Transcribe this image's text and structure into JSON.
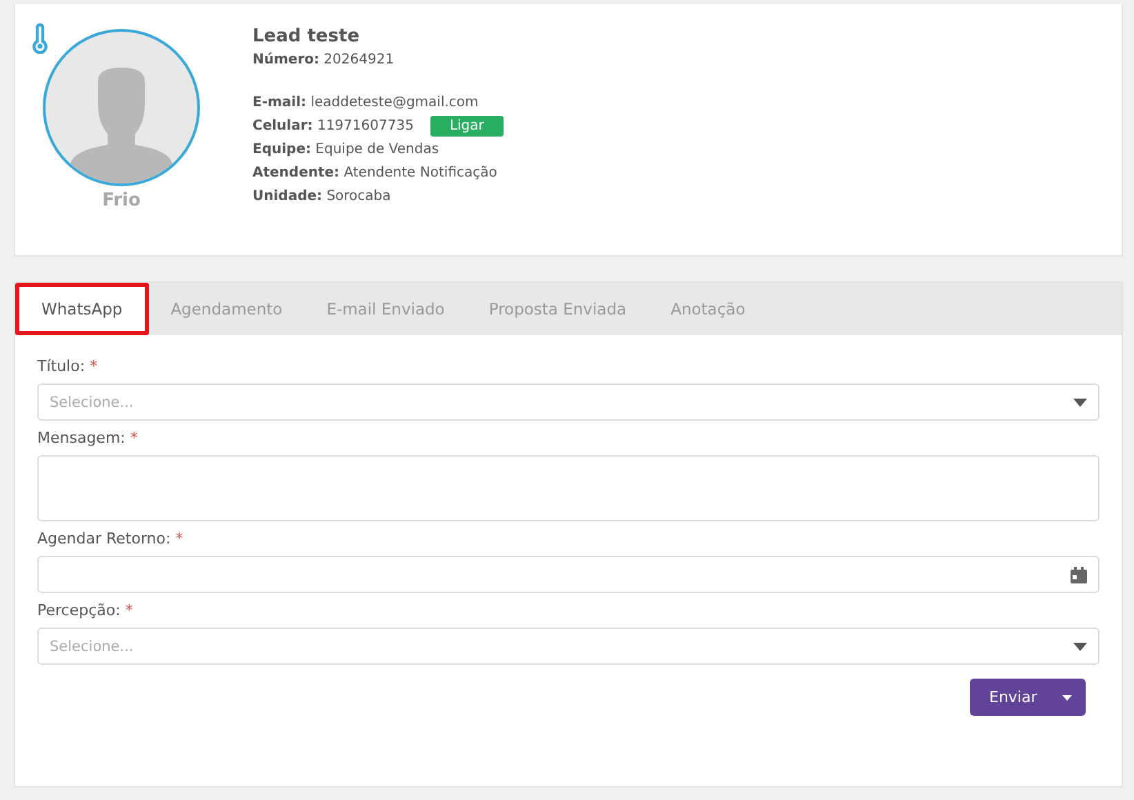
{
  "lead": {
    "name": "Lead teste",
    "temperature": "Frio",
    "number": {
      "label": "Número:",
      "value": "20264921"
    },
    "fields": [
      {
        "label": "E-mail:",
        "value": "leaddeteste@gmail.com"
      },
      {
        "label": "Celular:",
        "value": "11971607735",
        "action": "Ligar"
      },
      {
        "label": "Equipe:",
        "value": "Equipe de Vendas"
      },
      {
        "label": "Atendente:",
        "value": "Atendente Notificação"
      },
      {
        "label": "Unidade:",
        "value": "Sorocaba"
      }
    ]
  },
  "tabs": [
    {
      "label": "WhatsApp",
      "selected": true,
      "highlighted": true
    },
    {
      "label": "Agendamento",
      "selected": false,
      "highlighted": false
    },
    {
      "label": "E-mail Enviado",
      "selected": false,
      "highlighted": false
    },
    {
      "label": "Proposta Enviada",
      "selected": false,
      "highlighted": false
    },
    {
      "label": "Anotação",
      "selected": false,
      "highlighted": false
    }
  ],
  "form": {
    "fields": [
      {
        "kind": "select",
        "label": "Título:",
        "required": "*",
        "placeholder": "Selecione..."
      },
      {
        "kind": "textarea",
        "label": "Mensagem:",
        "required": "*"
      },
      {
        "kind": "date",
        "label": "Agendar Retorno:",
        "required": "*"
      },
      {
        "kind": "select",
        "label": "Percepção:",
        "required": "*",
        "placeholder": "Selecione..."
      }
    ],
    "submit": "Enviar"
  }
}
